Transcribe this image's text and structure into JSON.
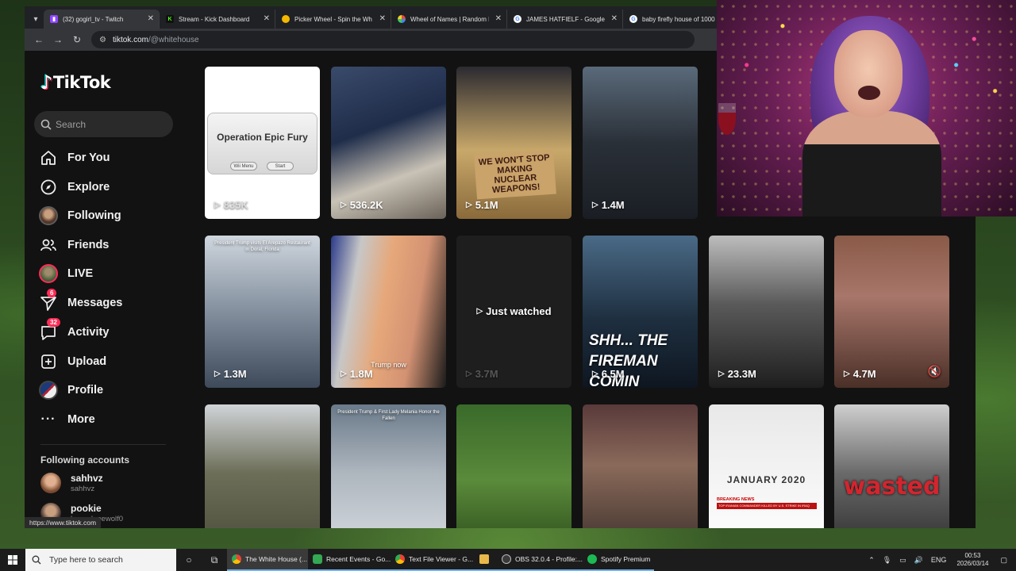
{
  "browser": {
    "tabs": [
      {
        "title": "(32) gogirl_tv - Twitch",
        "icon": "twitch-icon",
        "color": "#9146ff",
        "active": true
      },
      {
        "title": "Stream - Kick Dashboard",
        "icon": "kick-icon",
        "color": "#53fc18",
        "active": false
      },
      {
        "title": "Picker Wheel - Spin the Wh",
        "icon": "wheel-icon",
        "color": "#f5b800",
        "active": false
      },
      {
        "title": "Wheel of Names | Random N",
        "icon": "wheel-icon",
        "color": "#e84b3c",
        "active": false
      },
      {
        "title": "JAMES HATFIELF - Google S",
        "icon": "google-icon",
        "color": "#ffffff",
        "active": false
      },
      {
        "title": "baby firefly house of 1000",
        "icon": "google-icon",
        "color": "#ffffff",
        "active": false
      }
    ],
    "address": {
      "host": "tiktok.com",
      "path": "/@whitehouse"
    },
    "status_url": "https://www.tiktok.com"
  },
  "tiktok": {
    "logo": "TikTok",
    "search_placeholder": "Search",
    "nav": [
      {
        "label": "For You",
        "icon": "home-icon"
      },
      {
        "label": "Explore",
        "icon": "compass-icon"
      },
      {
        "label": "Following",
        "icon": "avatar-icon"
      },
      {
        "label": "Friends",
        "icon": "friends-icon"
      },
      {
        "label": "LIVE",
        "icon": "live-avatar-icon"
      },
      {
        "label": "Messages",
        "icon": "paper-plane-icon",
        "badge": "6"
      },
      {
        "label": "Activity",
        "icon": "inbox-icon",
        "badge": "32"
      },
      {
        "label": "Upload",
        "icon": "plus-square-icon"
      },
      {
        "label": "Profile",
        "icon": "profile-avatar-icon"
      },
      {
        "label": "More",
        "icon": "ellipsis-icon"
      }
    ],
    "following_title": "Following accounts",
    "accounts": [
      {
        "name": "sahhvz",
        "handle": "sahhvz"
      },
      {
        "name": "pookie",
        "handle": "lunarslonewolf0"
      }
    ],
    "videos": [
      {
        "views": "835K",
        "overlay": "Operation Epic Fury",
        "buttons": [
          "Wii Menu",
          "Start"
        ]
      },
      {
        "views": "536.2K"
      },
      {
        "views": "5.1M",
        "overlay": "WE WON'T STOP MAKING NUCLEAR WEAPONS!"
      },
      {
        "views": "1.4M"
      },
      {
        "views": "1.3M",
        "overlay": "President Trump visits El Arepazo Restaurant in Doral, Florida"
      },
      {
        "views": "1.8M",
        "overlay": "Trump now"
      },
      {
        "views": "3.7M",
        "overlay": "Just watched"
      },
      {
        "views": "6.5M",
        "overlay": "SHH... THE FIREMAN COMIN"
      },
      {
        "views": "23.3M"
      },
      {
        "views": "4.7M"
      },
      {
        "overlay": "President Trump & First Lady Melania Honor the Fallen"
      },
      {},
      {},
      {},
      {
        "overlay": "JANUARY 2020",
        "caption": "BREAKING NEWS",
        "subcaption": "TOP IRANIAN COMMANDER KILLED BY U.S. STRIKE IN IRAQ"
      },
      {
        "overlay": "wasted"
      }
    ]
  },
  "taskbar": {
    "search_placeholder": "Type here to search",
    "apps": [
      {
        "label": "The White House (...",
        "color": "#f4b400",
        "active": true
      },
      {
        "label": "Recent Events - Go...",
        "color": "#34a853",
        "active": false
      },
      {
        "label": "Text File Viewer - G...",
        "color": "#f4b400",
        "active": false
      },
      {
        "label": "",
        "color": "#e8b84a",
        "active": false
      },
      {
        "label": "OBS 32.0.4 - Profile:...",
        "color": "#3a3a3a",
        "active": false
      },
      {
        "label": "Spotify Premium",
        "color": "#1db954",
        "active": false
      }
    ],
    "language": "ENG",
    "time": "00:53",
    "date": "2026/03/14"
  },
  "colors": {
    "accent": "#fe2c55",
    "cyan": "#25f4ee",
    "bg": "#121212"
  }
}
